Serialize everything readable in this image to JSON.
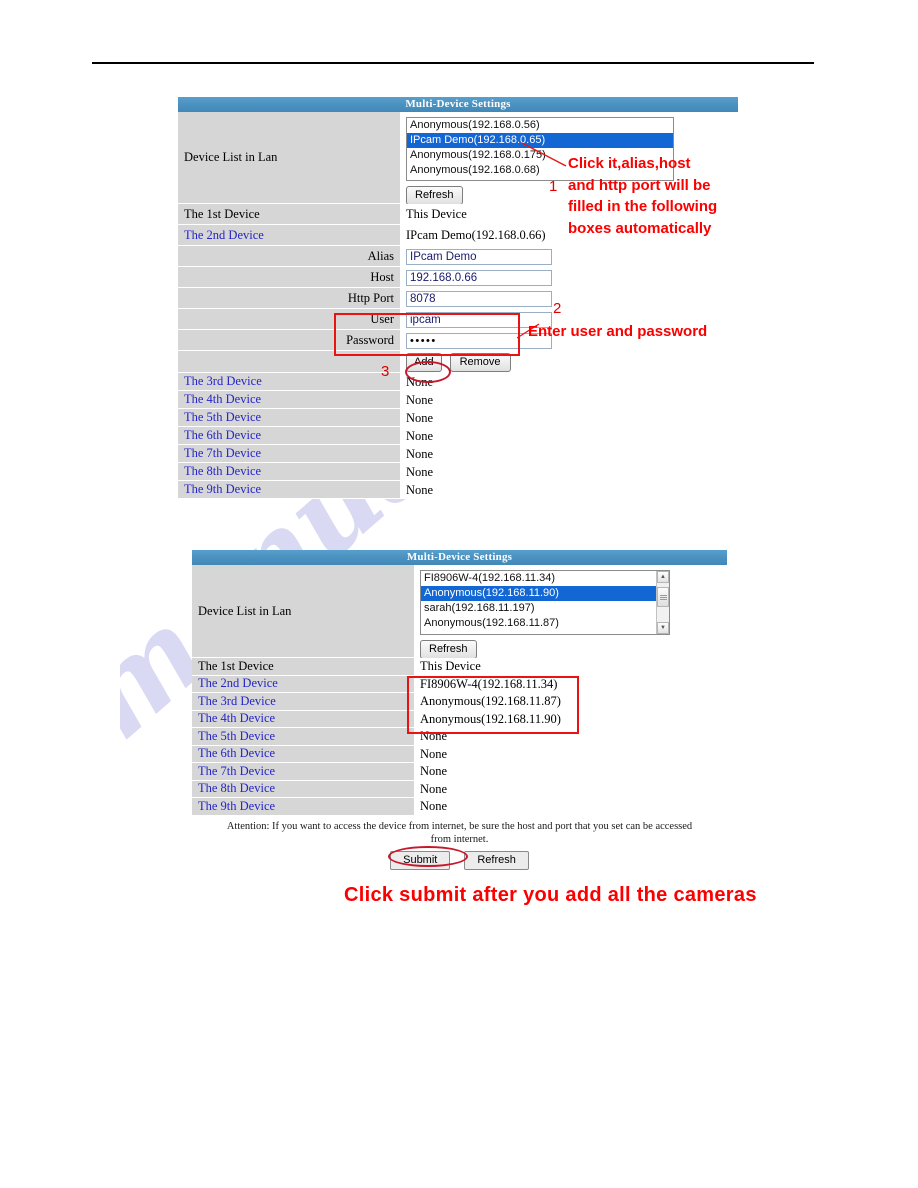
{
  "watermark": {
    "text": "manualsive.com"
  },
  "panel1": {
    "header": "Multi-Device Settings",
    "device_list_label": "Device List in Lan",
    "lan_options": [
      {
        "label": "Anonymous(192.168.0.56)",
        "selected": false
      },
      {
        "label": "IPcam Demo(192.168.0.65)",
        "selected": true
      },
      {
        "label": "Anonymous(192.168.0.175)",
        "selected": false
      },
      {
        "label": "Anonymous(192.168.0.68)",
        "selected": false
      }
    ],
    "refresh_label": "Refresh",
    "rows": [
      {
        "label": "The 1st Device",
        "value": "This Device"
      },
      {
        "label": "The 2nd Device",
        "value": "IPcam Demo(192.168.0.66)"
      }
    ],
    "fields": [
      {
        "label": "Alias",
        "value": "IPcam Demo"
      },
      {
        "label": "Host",
        "value": "192.168.0.66"
      },
      {
        "label": "Http Port",
        "value": "8078"
      },
      {
        "label": "User",
        "value": "ipcam"
      },
      {
        "label": "Password",
        "value": "•••••"
      }
    ],
    "add_label": "Add",
    "remove_label": "Remove",
    "empty_rows": [
      {
        "label": "The 3rd Device",
        "value": "None"
      },
      {
        "label": "The 4th Device",
        "value": "None"
      },
      {
        "label": "The 5th Device",
        "value": "None"
      },
      {
        "label": "The 6th Device",
        "value": "None"
      },
      {
        "label": "The 7th Device",
        "value": "None"
      },
      {
        "label": "The 8th Device",
        "value": "None"
      },
      {
        "label": "The 9th Device",
        "value": "None"
      }
    ],
    "annotations": {
      "note1_line1": "Click it,alias,host",
      "note1_line2": "and http port will be",
      "note1_line3": "filled in the following",
      "note1_line4": "boxes automatically",
      "note2": "Enter user and password",
      "num1": "1",
      "num2": "2",
      "num3": "3"
    }
  },
  "panel2": {
    "header": "Multi-Device Settings",
    "device_list_label": "Device List in Lan",
    "lan_options": [
      {
        "label": "FI8906W-4(192.168.11.34)",
        "selected": false
      },
      {
        "label": "Anonymous(192.168.11.90)",
        "selected": true
      },
      {
        "label": "sarah(192.168.11.197)",
        "selected": false
      },
      {
        "label": "Anonymous(192.168.11.87)",
        "selected": false
      }
    ],
    "refresh_label": "Refresh",
    "rows": [
      {
        "label": "The 1st Device",
        "value": "This Device"
      },
      {
        "label": "The 2nd Device",
        "value": "FI8906W-4(192.168.11.34)"
      },
      {
        "label": "The 3rd Device",
        "value": "Anonymous(192.168.11.87)"
      },
      {
        "label": "The 4th Device",
        "value": "Anonymous(192.168.11.90)"
      },
      {
        "label": "The 5th Device",
        "value": "None"
      },
      {
        "label": "The 6th Device",
        "value": "None"
      },
      {
        "label": "The 7th Device",
        "value": "None"
      },
      {
        "label": "The 8th Device",
        "value": "None"
      },
      {
        "label": "The 9th Device",
        "value": "None"
      }
    ],
    "attention_line1": "Attention: If you want to access the device from internet, be sure the host and port that you set can be accessed",
    "attention_line2": "from internet.",
    "submit_label": "Submit",
    "refresh_bottom_label": "Refresh",
    "caption": "Click submit after you add all the cameras"
  }
}
